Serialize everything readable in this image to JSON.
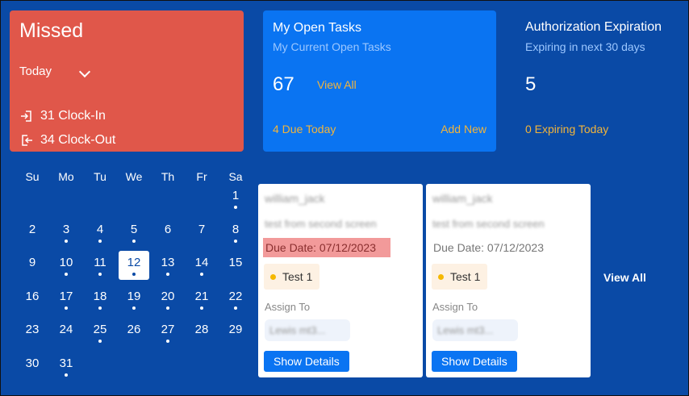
{
  "missed": {
    "title": "Missed",
    "filter": "Today",
    "clock_in": "31 Clock-In",
    "clock_out": "34 Clock-Out"
  },
  "open_tasks": {
    "title": "My Open Tasks",
    "subtitle": "My Current Open Tasks",
    "count": "67",
    "view_all": "View All",
    "due_today": "4 Due Today",
    "add_new": "Add New"
  },
  "authorization": {
    "title": "Authorization Expiration",
    "subtitle": "Expiring in next 30 days",
    "count": "5",
    "expiring_today": "0 Expiring Today"
  },
  "calendar": {
    "weekdays": [
      "Su",
      "Mo",
      "Tu",
      "We",
      "Th",
      "Fr",
      "Sa"
    ],
    "selected_day": "12",
    "weeks": [
      [
        null,
        null,
        null,
        null,
        null,
        null,
        {
          "d": "1",
          "dot": true
        }
      ],
      [
        {
          "d": "2",
          "dot": false
        },
        {
          "d": "3",
          "dot": true
        },
        {
          "d": "4",
          "dot": true
        },
        {
          "d": "5",
          "dot": true
        },
        {
          "d": "6",
          "dot": false
        },
        {
          "d": "7",
          "dot": false
        },
        {
          "d": "8",
          "dot": true
        }
      ],
      [
        {
          "d": "9",
          "dot": false
        },
        {
          "d": "10",
          "dot": true
        },
        {
          "d": "11",
          "dot": true
        },
        {
          "d": "12",
          "dot": true
        },
        {
          "d": "13",
          "dot": true
        },
        {
          "d": "14",
          "dot": true
        },
        {
          "d": "15",
          "dot": false
        }
      ],
      [
        {
          "d": "16",
          "dot": false
        },
        {
          "d": "17",
          "dot": true
        },
        {
          "d": "18",
          "dot": true
        },
        {
          "d": "19",
          "dot": true
        },
        {
          "d": "20",
          "dot": true
        },
        {
          "d": "21",
          "dot": true
        },
        {
          "d": "22",
          "dot": true
        }
      ],
      [
        {
          "d": "23",
          "dot": false
        },
        {
          "d": "24",
          "dot": false
        },
        {
          "d": "25",
          "dot": true
        },
        {
          "d": "26",
          "dot": false
        },
        {
          "d": "27",
          "dot": true
        },
        {
          "d": "28",
          "dot": false
        },
        {
          "d": "29",
          "dot": false
        }
      ],
      [
        {
          "d": "30",
          "dot": false
        },
        {
          "d": "31",
          "dot": true
        },
        null,
        null,
        null,
        null,
        null
      ]
    ]
  },
  "task_cards": [
    {
      "name": "william_jack",
      "description": "test from second screen",
      "due_date": "Due Date: 07/12/2023",
      "highlight": true,
      "tag": "Test 1",
      "assign_label": "Assign To",
      "assignee": "Lewis mt3...",
      "button": "Show Details"
    },
    {
      "name": "william_jack",
      "description": "test from second screen",
      "due_date": "Due Date: 07/12/2023",
      "highlight": false,
      "tag": "Test 1",
      "assign_label": "Assign To",
      "assignee": "Lewis mt3...",
      "button": "Show Details"
    }
  ],
  "cards_view_all": "View All",
  "colors": {
    "background": "#0a4aa6",
    "missed": "#e0574a",
    "tasks": "#0a74f2",
    "accent": "#f2b43b",
    "due_highlight": "#f29a9a"
  },
  "icons": {
    "clock_in": "login-icon",
    "clock_out": "logout-icon",
    "filter": "chevron-down-icon"
  }
}
